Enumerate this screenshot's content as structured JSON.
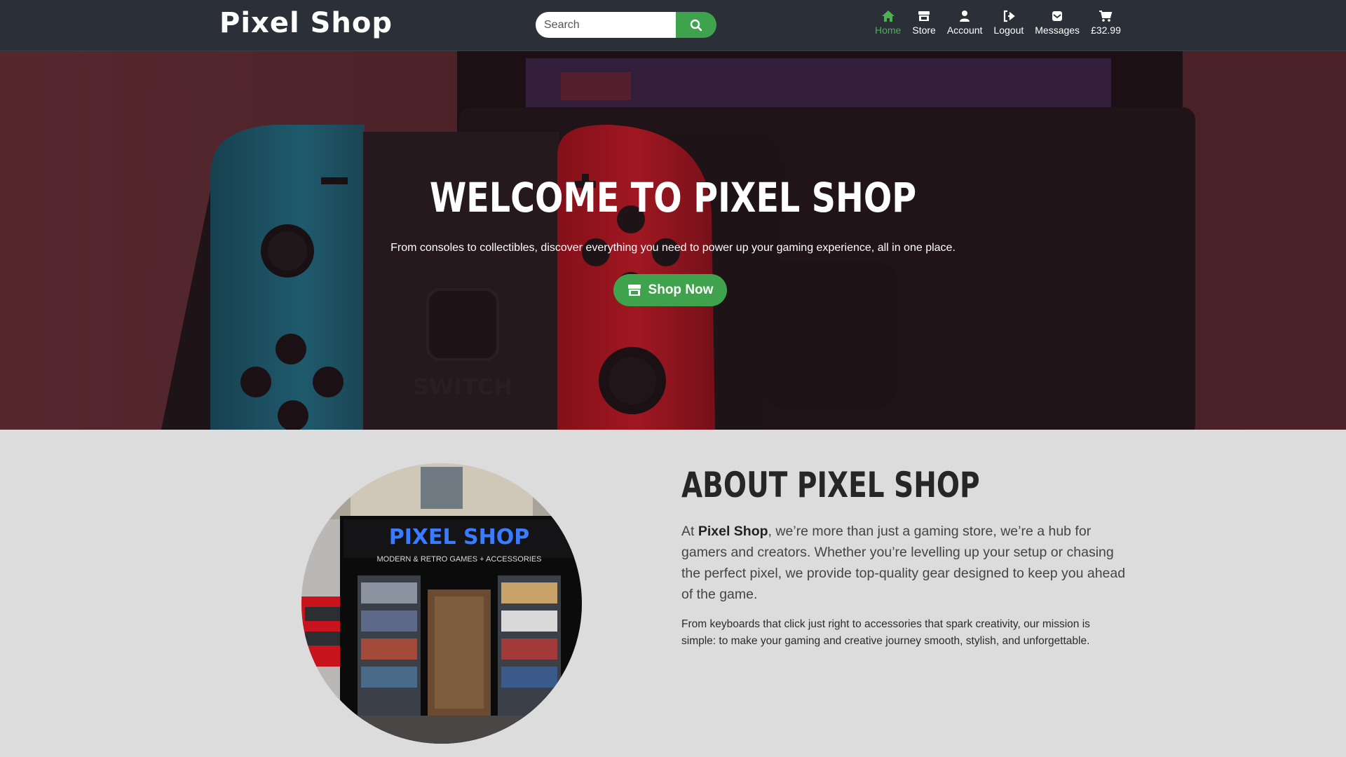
{
  "header": {
    "logo": "Pixel Shop",
    "search_placeholder": "Search",
    "search_icon": "search-icon"
  },
  "nav": {
    "items": [
      {
        "label": "Home",
        "icon": "home-icon",
        "active": true
      },
      {
        "label": "Store",
        "icon": "store-icon"
      },
      {
        "label": "Account",
        "icon": "user-icon"
      },
      {
        "label": "Logout",
        "icon": "logout-icon"
      },
      {
        "label": "Messages",
        "icon": "envelope-icon"
      },
      {
        "label": "£32.99",
        "icon": "cart-icon"
      }
    ]
  },
  "hero": {
    "title": "WELCOME TO PIXEL SHOP",
    "subtitle": "From consoles to collectibles, discover everything you need to power up your gaming experience, all in one place.",
    "button_label": "Shop Now",
    "button_icon": "store-icon"
  },
  "about": {
    "title": "ABOUT PIXEL SHOP",
    "p1_prefix": "At ",
    "p1_brand": "Pixel Shop",
    "p1_rest": ", we’re more than just a gaming store, we’re a hub for gamers and creators. Whether you’re levelling up your setup or chasing the perfect pixel, we provide top-quality gear designed to keep you ahead of the game.",
    "p2": "From keyboards that click just right to accessories that spark creativity, our mission is simple: to make your gaming and creative journey smooth, stylish, and unforgettable.",
    "storefront": {
      "sign": "PIXEL SHOP",
      "sign_sub": "MODERN & RETRO GAMES + ACCESSORIES"
    }
  },
  "colors": {
    "nav_bg": "#2b2f38",
    "accent": "#3fa34d",
    "active_nav": "#4caf50",
    "about_bg": "#dcdcdc"
  }
}
